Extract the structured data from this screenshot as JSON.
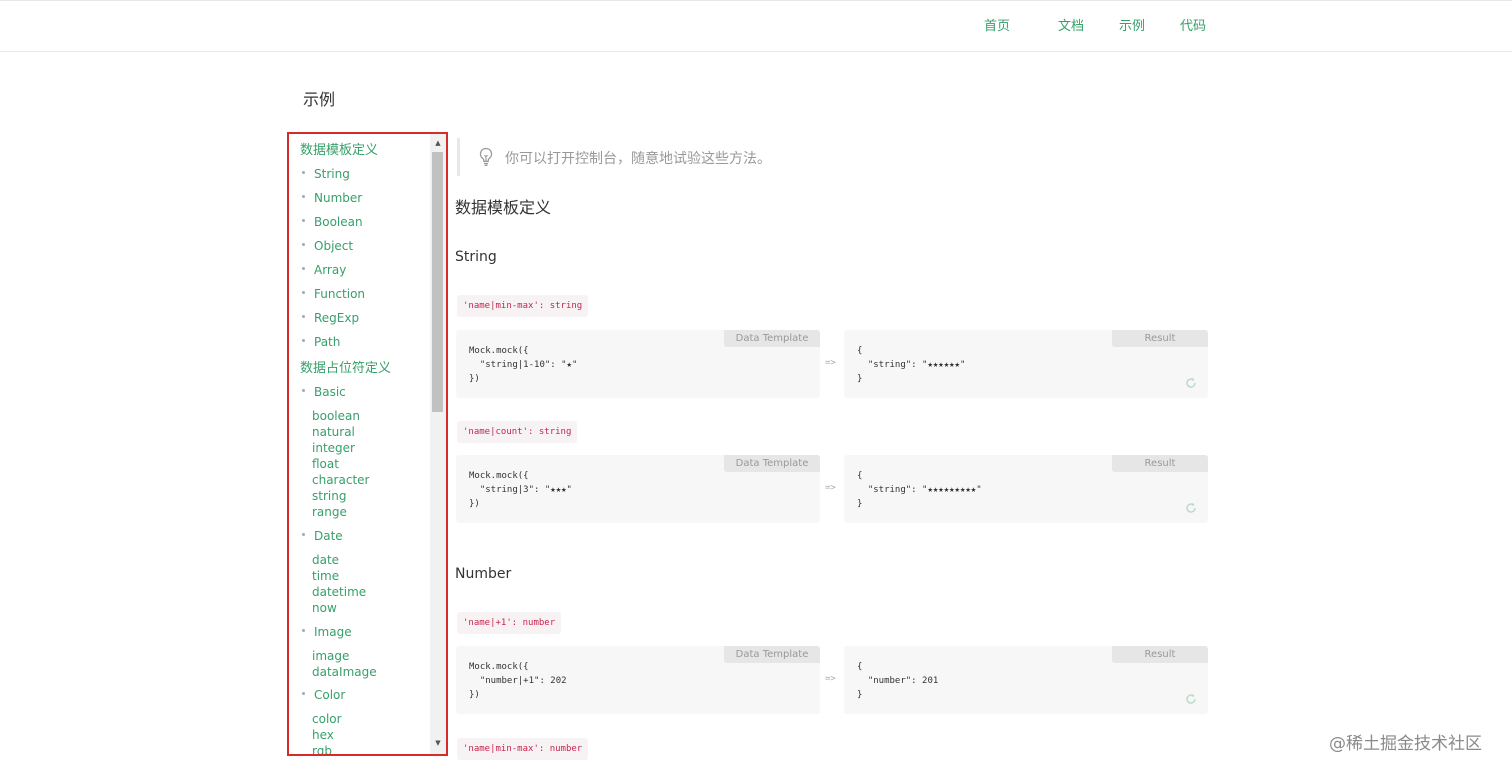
{
  "nav": [
    "首页",
    "文档",
    "示例",
    "代码"
  ],
  "page_title": "示例",
  "sidebar": {
    "group1": "数据模板定义",
    "group1_items": [
      "String",
      "Number",
      "Boolean",
      "Object",
      "Array",
      "Function",
      "RegExp",
      "Path"
    ],
    "group2": "数据占位符定义",
    "basic": "Basic",
    "basic_subs": [
      "boolean",
      "natural",
      "integer",
      "float",
      "character",
      "string",
      "range"
    ],
    "date": "Date",
    "date_subs": [
      "date",
      "time",
      "datetime",
      "now"
    ],
    "image": "Image",
    "image_subs": [
      "image",
      "dataImage"
    ],
    "color": "Color",
    "color_subs": [
      "color",
      "hex",
      "rgb"
    ]
  },
  "tip": "你可以打开控制台，随意地试验这些方法。",
  "section_title": "数据模板定义",
  "string_title": "String",
  "number_title": "Number",
  "examples": [
    {
      "rule": "'name|min-max': string",
      "template_label": "Data Template",
      "template": "Mock.mock({\n  \"string|1-10\": \"★\"\n})",
      "arrow": "=>",
      "result_label": "Result",
      "result": "{\n  \"string\": \"★★★★★★\"\n}"
    },
    {
      "rule": "'name|count': string",
      "template_label": "Data Template",
      "template": "Mock.mock({\n  \"string|3\": \"★★★\"\n})",
      "arrow": "=>",
      "result_label": "Result",
      "result": "{\n  \"string\": \"★★★★★★★★★\"\n}"
    },
    {
      "rule": "'name|+1': number",
      "template_label": "Data Template",
      "template": "Mock.mock({\n  \"number|+1\": 202\n})",
      "arrow": "=>",
      "result_label": "Result",
      "result": "{\n  \"number\": 201\n}"
    },
    {
      "rule": "'name|min-max': number"
    }
  ],
  "watermark": "@稀土掘金技术社区",
  "colors": {
    "accent": "#36a06a",
    "highlight_border": "#d62b2b",
    "code_red": "#c7254e"
  }
}
